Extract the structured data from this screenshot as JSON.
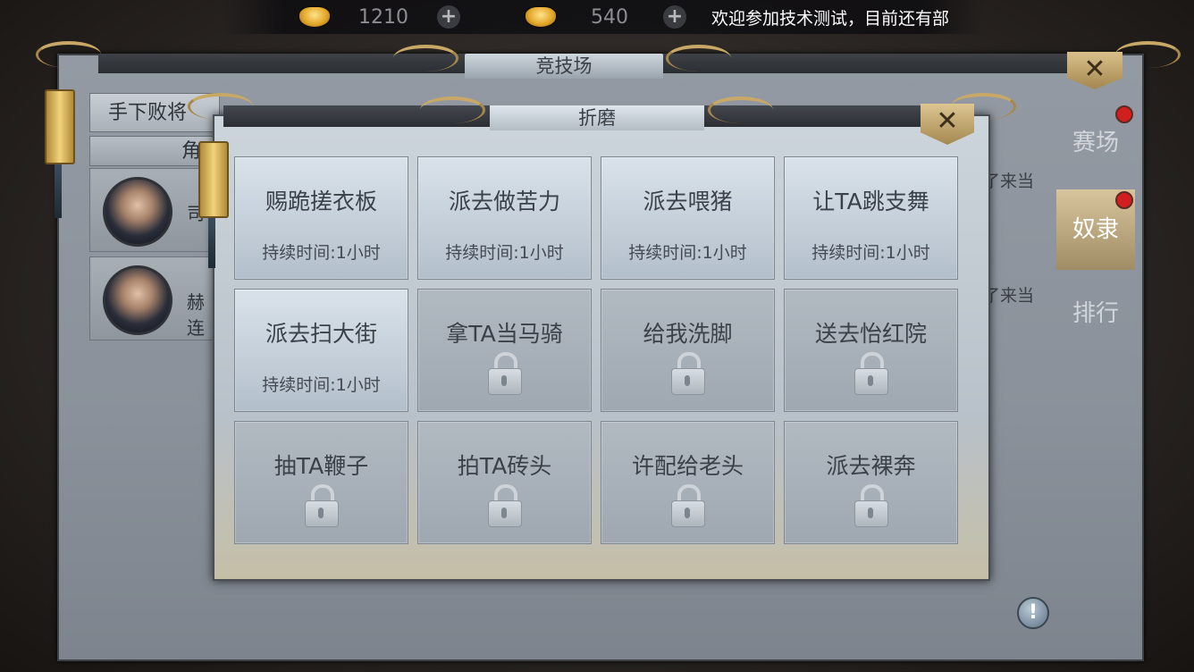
{
  "resources": [
    {
      "icon": "gold-ingot-icon",
      "amount": "1210"
    },
    {
      "icon": "gold-ingot-icon",
      "amount": "540"
    }
  ],
  "notice": "欢迎参加技术测试，目前还有部",
  "arena": {
    "title": "竞技场",
    "left_tab": "手下败将",
    "left_sub": "角",
    "rows": [
      {
        "name": "司"
      },
      {
        "name": "赫连"
      }
    ],
    "bg_text": [
      "了来当",
      "了来当"
    ]
  },
  "side_tabs": [
    {
      "label": "赛场",
      "active": false,
      "dot": true
    },
    {
      "label": "奴隶",
      "active": true,
      "dot": true
    },
    {
      "label": "排行",
      "active": false,
      "dot": false
    }
  ],
  "dialog": {
    "title": "折磨",
    "actions": [
      {
        "name": "赐跪搓衣板",
        "duration": "持续时间:1小时",
        "locked": false
      },
      {
        "name": "派去做苦力",
        "duration": "持续时间:1小时",
        "locked": false
      },
      {
        "name": "派去喂猪",
        "duration": "持续时间:1小时",
        "locked": false
      },
      {
        "name": "让TA跳支舞",
        "duration": "持续时间:1小时",
        "locked": false
      },
      {
        "name": "派去扫大街",
        "duration": "持续时间:1小时",
        "locked": false
      },
      {
        "name": "拿TA当马骑",
        "duration": "",
        "locked": true
      },
      {
        "name": "给我洗脚",
        "duration": "",
        "locked": true
      },
      {
        "name": "送去怡红院",
        "duration": "",
        "locked": true
      },
      {
        "name": "抽TA鞭子",
        "duration": "",
        "locked": true
      },
      {
        "name": "拍TA砖头",
        "duration": "",
        "locked": true
      },
      {
        "name": "许配给老头",
        "duration": "",
        "locked": true
      },
      {
        "name": "派去裸奔",
        "duration": "",
        "locked": true
      }
    ]
  },
  "colors": {
    "accent_gold": "#c8a866",
    "alert_red": "#d11f1f"
  }
}
